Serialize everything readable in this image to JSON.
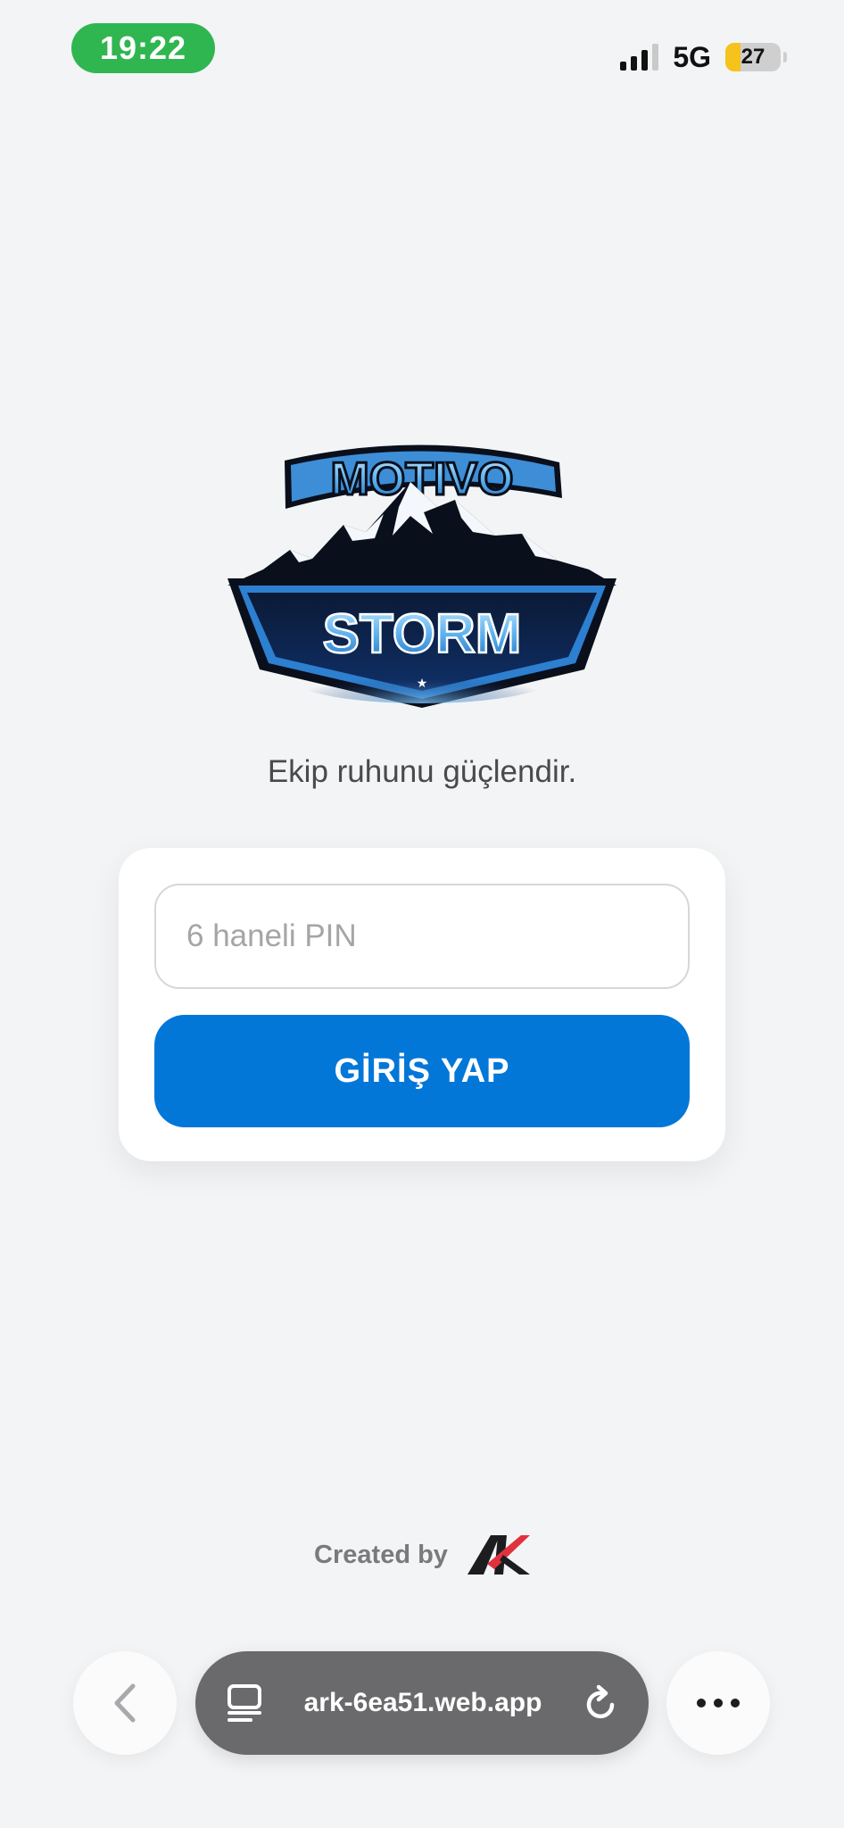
{
  "status_bar": {
    "time": "19:22",
    "network": "5G",
    "battery": "27",
    "battery_level": 0.27
  },
  "logo": {
    "top_text": "MOTIVO",
    "bottom_text": "STORM",
    "alt": "Motivo Storm logo"
  },
  "tagline": "Ekip ruhunu güçlendir.",
  "login_card": {
    "pin_placeholder": "6 haneli PIN",
    "pin_value": "",
    "submit_label": "GİRİŞ YAP"
  },
  "footer": {
    "created_by": "Created by",
    "creator_logo": "AK"
  },
  "browser_bar": {
    "url": "ark-6ea51.web.app",
    "back_icon": "chevron-left-icon",
    "tabs_icon": "tab-overview-icon",
    "reload_icon": "reload-icon",
    "more_icon": "more-icon"
  }
}
